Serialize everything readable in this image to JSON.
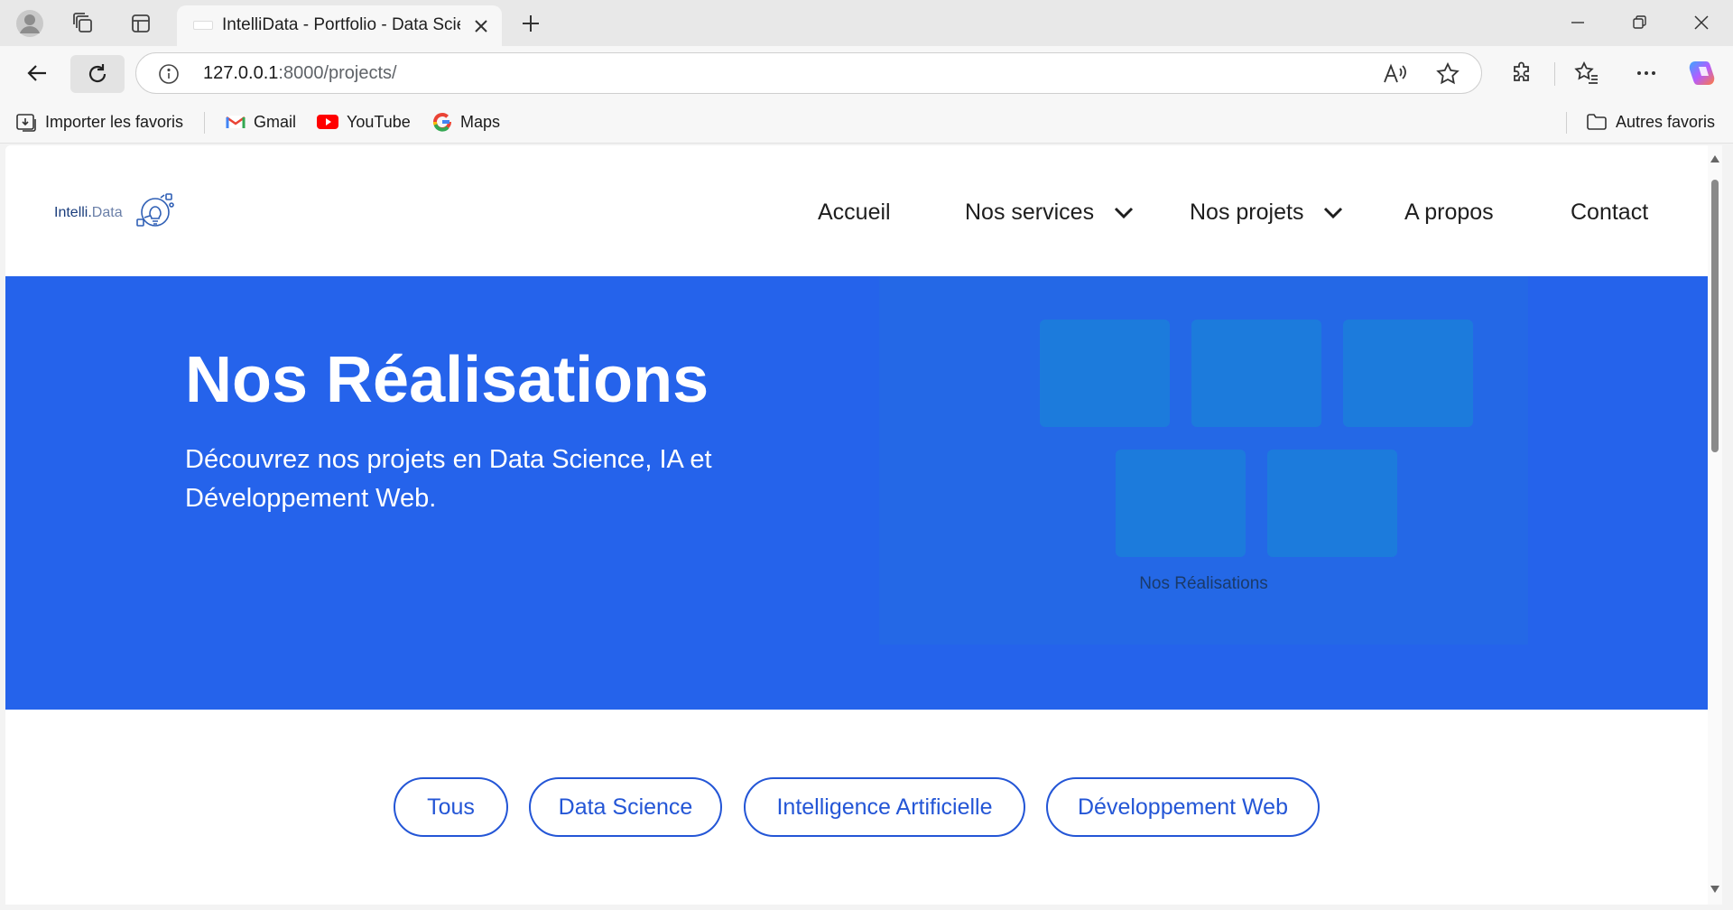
{
  "browser": {
    "tab_title": "IntelliData - Portfolio - Data Science",
    "url_host": "127.0.0.1",
    "url_path": ":8000/projects/",
    "bookmarks": [
      {
        "label": "Importer les favoris",
        "icon": "import-icon"
      },
      {
        "label": "Gmail",
        "icon": "gmail-icon"
      },
      {
        "label": "YouTube",
        "icon": "youtube-icon"
      },
      {
        "label": "Maps",
        "icon": "google-icon"
      }
    ],
    "other_bookmarks": "Autres favoris"
  },
  "site": {
    "logo_main": "Intelli.",
    "logo_accent": "Data",
    "menu": [
      {
        "label": "Accueil",
        "dropdown": false
      },
      {
        "label": "Nos services",
        "dropdown": true
      },
      {
        "label": "Nos projets",
        "dropdown": true
      },
      {
        "label": "A propos",
        "dropdown": false
      },
      {
        "label": "Contact",
        "dropdown": false
      }
    ]
  },
  "hero": {
    "title": "Nos Réalisations",
    "subtitle": "Découvrez nos projets en Data Science, IA et Développement Web.",
    "image_label": "Nos Réalisations"
  },
  "filters": [
    "Tous",
    "Data Science",
    "Intelligence Artificielle",
    "Développement Web"
  ],
  "colors": {
    "brand_blue": "#2563eb",
    "filter_accent": "#2456d6",
    "tile": "#1c7bdc"
  }
}
